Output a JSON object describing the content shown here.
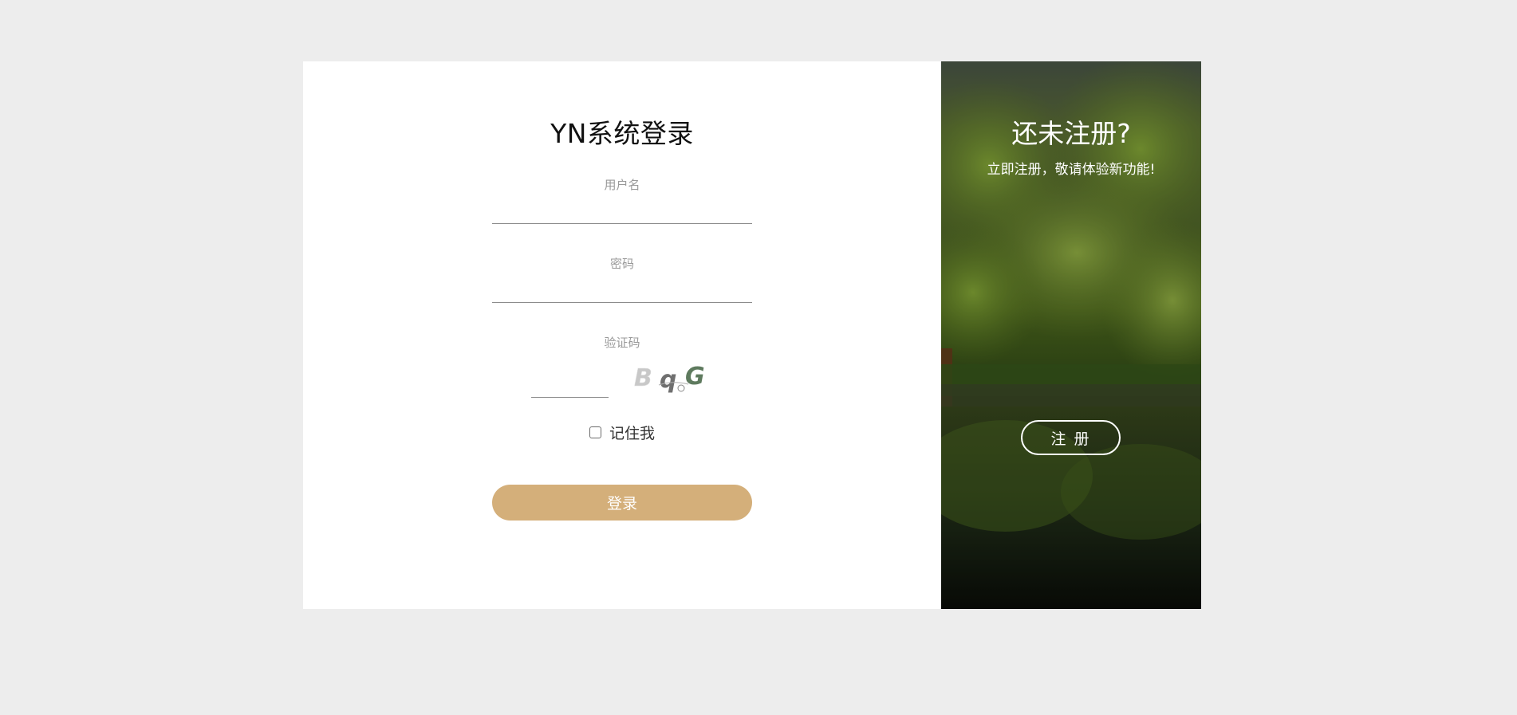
{
  "login": {
    "title": "YN系统登录",
    "username": {
      "label": "用户名",
      "value": ""
    },
    "password": {
      "label": "密码",
      "value": ""
    },
    "captcha": {
      "label": "验证码",
      "value": "",
      "image_text": "BqG"
    },
    "remember": {
      "label": "记住我",
      "checked": false
    },
    "submit_label": "登录"
  },
  "side": {
    "title": "还未注册?",
    "subtitle": "立即注册，敬请体验新功能!",
    "register_label": "注 册"
  },
  "colors": {
    "page_bg": "#ededed",
    "card_bg": "#ffffff",
    "accent": "#d4af7a",
    "label": "#999999"
  }
}
